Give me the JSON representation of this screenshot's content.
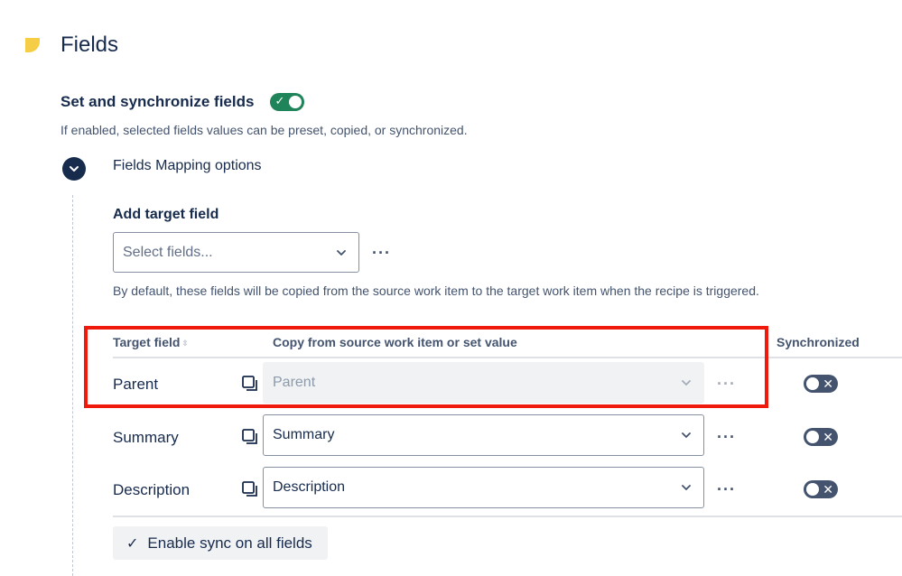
{
  "page": {
    "title": "Fields"
  },
  "toggle": {
    "label": "Set and synchronize fields",
    "state": "on",
    "helper": "If enabled, selected fields values can be preset, copied, or synchronized."
  },
  "mapping": {
    "label": "Fields Mapping options",
    "expanded": true
  },
  "add_target": {
    "label": "Add target field",
    "placeholder": "Select fields...",
    "note": "By default, these fields will be copied from the source work item to the target work item when the recipe is triggered."
  },
  "table": {
    "columns": [
      "Target field",
      "Copy from source work item or set value",
      "Synchronized"
    ],
    "rows": [
      {
        "label": "Parent",
        "value": "Parent",
        "disabled": true,
        "synchronized": false
      },
      {
        "label": "Summary",
        "value": "Summary",
        "disabled": false,
        "synchronized": false
      },
      {
        "label": "Description",
        "value": "Description",
        "disabled": false,
        "synchronized": false
      }
    ]
  },
  "enable_sync": {
    "label": "Enable sync on all fields"
  },
  "colors": {
    "accent_green": "#1f845a",
    "highlight_red": "#f01a0c",
    "text_dark": "#172b4d",
    "section_marker": "#f5cd47"
  },
  "icons": [
    "check-icon",
    "chevron-down-icon",
    "more-icon",
    "copy-icon",
    "close-icon",
    "sort-icon"
  ]
}
